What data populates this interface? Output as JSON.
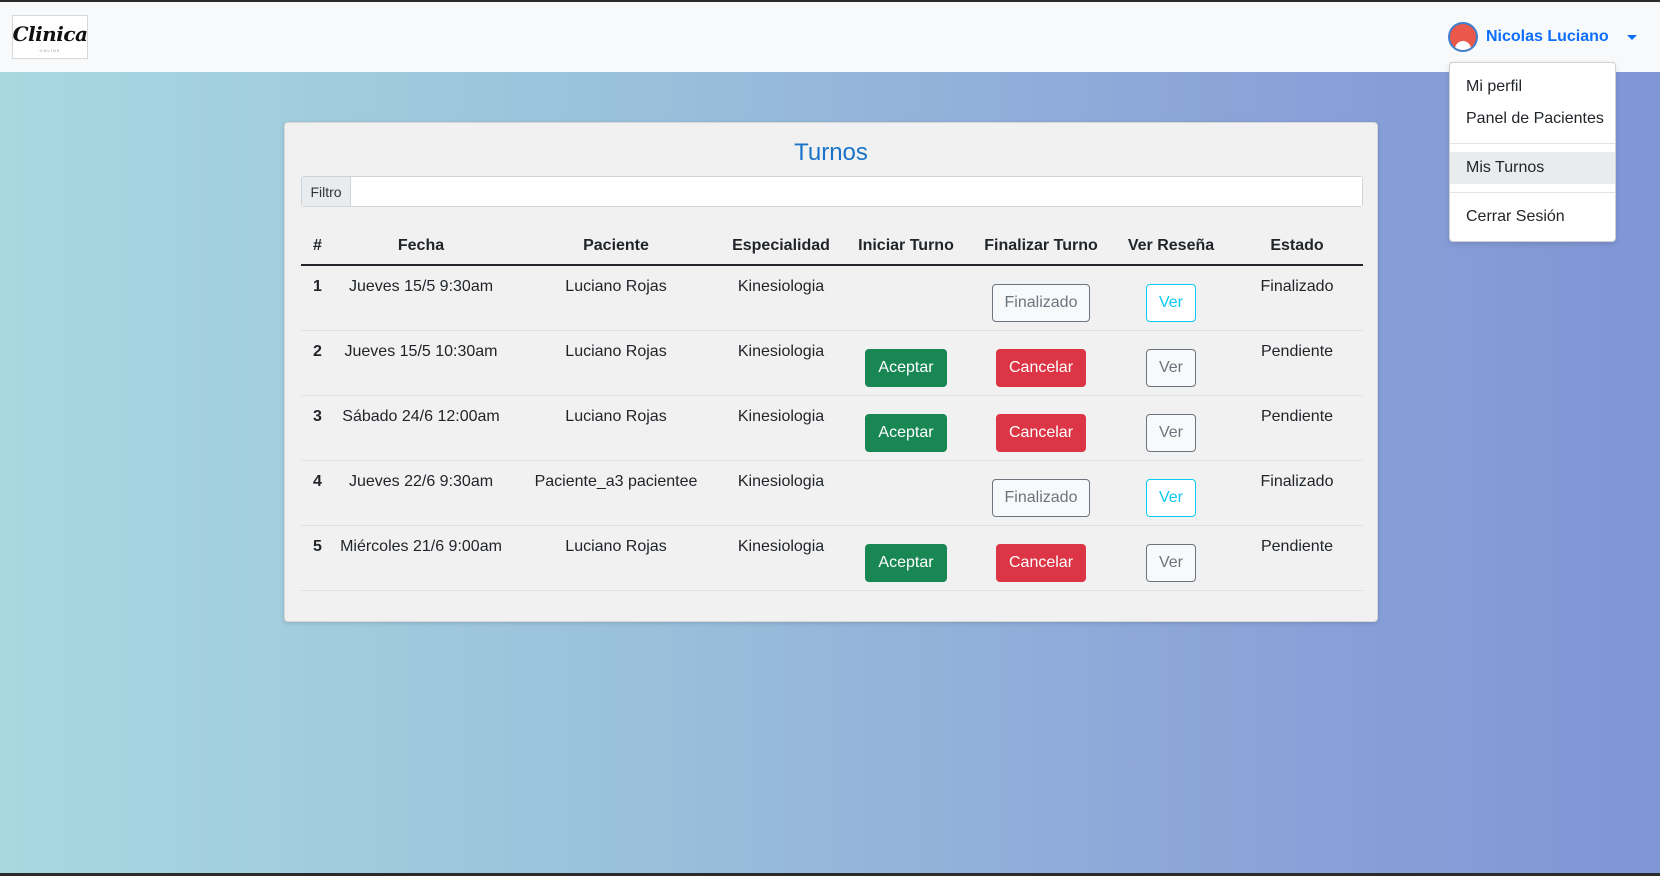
{
  "navbar": {
    "logo_text": "Clinica",
    "logo_sub": "ONLINE",
    "user_name": "Nicolas Luciano"
  },
  "dropdown": {
    "items": [
      "Mi perfil",
      "Panel de Pacientes",
      "Mis Turnos",
      "Cerrar Sesión"
    ],
    "active": "Mis Turnos"
  },
  "card": {
    "title": "Turnos",
    "filter_label": "Filtro",
    "filter_value": ""
  },
  "table": {
    "headers": [
      "#",
      "Fecha",
      "Paciente",
      "Especialidad",
      "Iniciar Turno",
      "Finalizar Turno",
      "Ver Reseña",
      "Estado"
    ],
    "rows": [
      {
        "num": "1",
        "fecha": "Jueves 15/5 9:30am",
        "paciente": "Luciano Rojas",
        "especialidad": "Kinesiologia",
        "iniciar": "",
        "finalizar": "Finalizado",
        "ver": "Ver",
        "estado": "Finalizado"
      },
      {
        "num": "2",
        "fecha": "Jueves 15/5 10:30am",
        "paciente": "Luciano Rojas",
        "especialidad": "Kinesiologia",
        "iniciar": "Aceptar",
        "finalizar": "Cancelar",
        "ver": "Ver",
        "estado": "Pendiente"
      },
      {
        "num": "3",
        "fecha": "Sábado 24/6 12:00am",
        "paciente": "Luciano Rojas",
        "especialidad": "Kinesiologia",
        "iniciar": "Aceptar",
        "finalizar": "Cancelar",
        "ver": "Ver",
        "estado": "Pendiente"
      },
      {
        "num": "4",
        "fecha": "Jueves 22/6 9:30am",
        "paciente": "Paciente_a3 pacientee",
        "especialidad": "Kinesiologia",
        "iniciar": "",
        "finalizar": "Finalizado",
        "ver": "Ver",
        "estado": "Finalizado"
      },
      {
        "num": "5",
        "fecha": "Miércoles 21/6 9:00am",
        "paciente": "Luciano Rojas",
        "especialidad": "Kinesiologia",
        "iniciar": "Aceptar",
        "finalizar": "Cancelar",
        "ver": "Ver",
        "estado": "Pendiente"
      }
    ]
  },
  "colors": {
    "primary": "#0d6efd",
    "title": "#1a73c9",
    "success": "#198754",
    "danger": "#dc3545",
    "info": "#0dcaf0",
    "secondary": "#6c757d"
  }
}
